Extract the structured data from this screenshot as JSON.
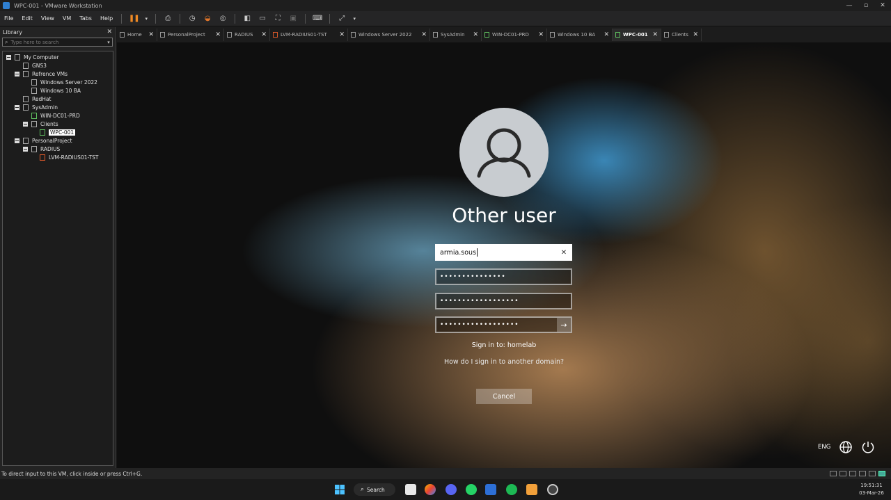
{
  "window": {
    "title": "WPC-001 - VMware Workstation"
  },
  "menu": [
    "File",
    "Edit",
    "View",
    "VM",
    "Tabs",
    "Help"
  ],
  "library": {
    "title": "Library",
    "search_placeholder": "Type here to search",
    "tree": [
      {
        "label": "My Computer"
      },
      {
        "label": "GNS3"
      },
      {
        "label": "Refrence VMs"
      },
      {
        "label": "Windows Server 2022"
      },
      {
        "label": "Windows 10 BA"
      },
      {
        "label": "RedHat"
      },
      {
        "label": "SysAdmin"
      },
      {
        "label": "WIN-DC01-PRD"
      },
      {
        "label": "Clients"
      },
      {
        "label": "WPC-001"
      },
      {
        "label": "PersonalProject"
      },
      {
        "label": "RADIUS"
      },
      {
        "label": "LVM-RADIUS01-TST"
      }
    ]
  },
  "tabs": [
    "Home",
    "PersonalProject",
    "RADIUS",
    "LVM-RADIUS01-TST",
    "Windows Server 2022",
    "SysAdmin",
    "WIN-DC01-PRD",
    "Windows 10 BA",
    "WPC-001",
    "Clients"
  ],
  "login": {
    "heading": "Other user",
    "username": "armia.sous",
    "password1": "•••••••••••••••",
    "password2": "••••••••••••••••••",
    "password3": "••••••••••••••••••",
    "signin_to": "Sign in to: homelab",
    "other_domain": "How do I sign in to another domain?",
    "cancel": "Cancel",
    "language": "ENG"
  },
  "status": {
    "text": "To direct input to this VM, click inside or press Ctrl+G."
  },
  "taskbar": {
    "search_label": "Search",
    "time": "19:51:31",
    "date": "03-Mar-26"
  }
}
